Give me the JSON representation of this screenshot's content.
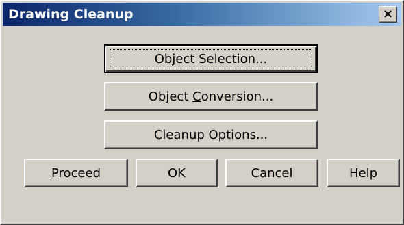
{
  "window": {
    "title": "Drawing Cleanup",
    "close_label": "×"
  },
  "buttons": {
    "object_selection": {
      "before": "Object ",
      "mnemonic": "S",
      "after": "election..."
    },
    "object_conversion": {
      "before": "Object ",
      "mnemonic": "C",
      "after": "onversion..."
    },
    "cleanup_options": {
      "before": "Cleanup ",
      "mnemonic": "O",
      "after": "ptions..."
    },
    "proceed": {
      "before": "",
      "mnemonic": "P",
      "after": "roceed"
    },
    "ok": {
      "label": "OK"
    },
    "cancel": {
      "label": "Cancel"
    },
    "help": {
      "label": "Help"
    }
  },
  "colors": {
    "face": "#d4d0c8",
    "title_start": "#0a246a",
    "title_end": "#a6caf0"
  },
  "focused_button": "Object Selection..."
}
